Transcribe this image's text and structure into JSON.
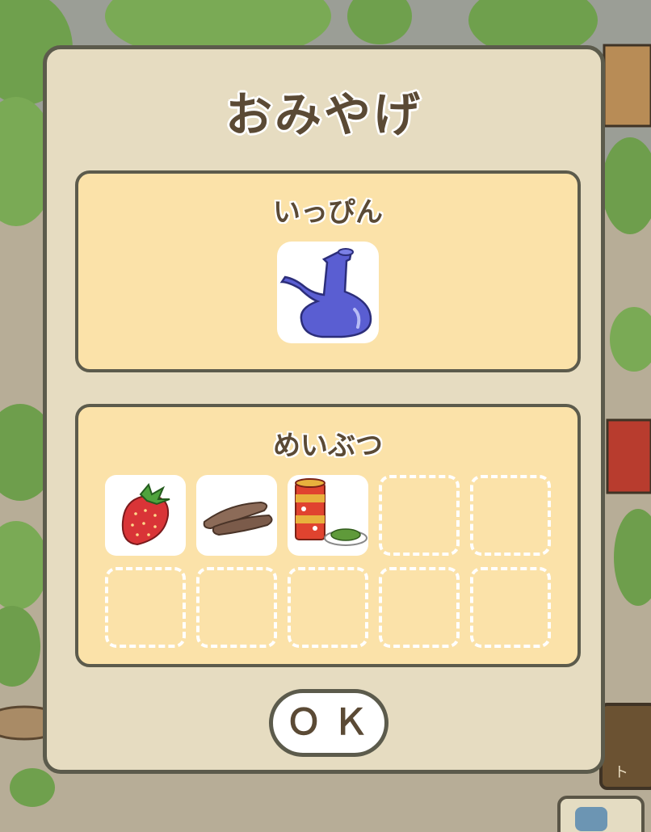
{
  "dialog": {
    "title": "おみやげ",
    "special_item_section": {
      "label": "いっぴん",
      "item": {
        "icon": "blue-porcelain-pot-icon"
      }
    },
    "local_specialties_section": {
      "label": "めいぶつ",
      "slots": [
        {
          "icon": "strawberry-icon"
        },
        {
          "icon": "dried-food-icon"
        },
        {
          "icon": "tea-canister-icon"
        },
        {
          "icon": null
        },
        {
          "icon": null
        },
        {
          "icon": null
        },
        {
          "icon": null
        },
        {
          "icon": null
        },
        {
          "icon": null
        },
        {
          "icon": null
        }
      ]
    },
    "ok_label": "ＯＫ"
  },
  "background": {
    "corner_sign_text": "ト"
  },
  "colors": {
    "dialog_bg": "#e6dcc1",
    "panel_bg": "#fbe2a9",
    "border": "#5c5b4c",
    "text": "#5b4a35"
  }
}
